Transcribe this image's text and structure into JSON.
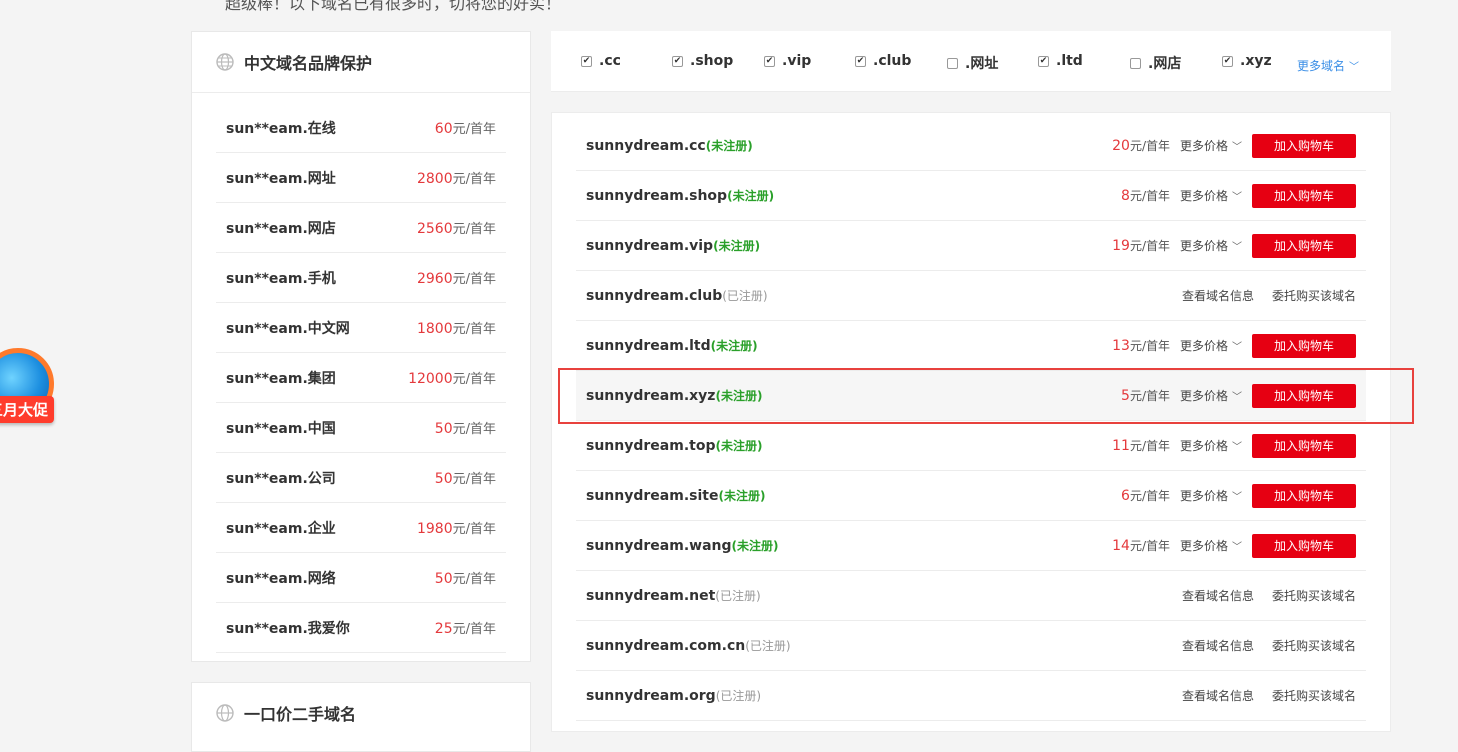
{
  "top_text": "超级棒！以下域名已有很多时，切将您的好实！",
  "left_panel": {
    "title": "中文域名品牌保护",
    "items": [
      {
        "name": "sun**eam.在线",
        "price": "60",
        "unit": "元/首年"
      },
      {
        "name": "sun**eam.网址",
        "price": "2800",
        "unit": "元/首年"
      },
      {
        "name": "sun**eam.网店",
        "price": "2560",
        "unit": "元/首年"
      },
      {
        "name": "sun**eam.手机",
        "price": "2960",
        "unit": "元/首年"
      },
      {
        "name": "sun**eam.中文网",
        "price": "1800",
        "unit": "元/首年"
      },
      {
        "name": "sun**eam.集团",
        "price": "12000",
        "unit": "元/首年"
      },
      {
        "name": "sun**eam.中国",
        "price": "50",
        "unit": "元/首年"
      },
      {
        "name": "sun**eam.公司",
        "price": "50",
        "unit": "元/首年"
      },
      {
        "name": "sun**eam.企业",
        "price": "1980",
        "unit": "元/首年"
      },
      {
        "name": "sun**eam.网络",
        "price": "50",
        "unit": "元/首年"
      },
      {
        "name": "sun**eam.我爱你",
        "price": "25",
        "unit": "元/首年"
      }
    ]
  },
  "left_panel2": {
    "title": "一口价二手域名"
  },
  "promo": {
    "label": "三月大促"
  },
  "filters": {
    "items": [
      {
        "label": ".cc",
        "checked": true
      },
      {
        "label": ".shop",
        "checked": true
      },
      {
        "label": ".vip",
        "checked": true
      },
      {
        "label": ".club",
        "checked": true
      },
      {
        "label": ".网址",
        "checked": false
      },
      {
        "label": ".ltd",
        "checked": true
      },
      {
        "label": ".网店",
        "checked": false
      },
      {
        "label": ".xyz",
        "checked": true
      }
    ],
    "more_label": "更多域名"
  },
  "results": {
    "cart_label": "加入购物车",
    "more_price_label": "更多价格",
    "whois_label": "查看域名信息",
    "broker_label": "委托购买该域名",
    "price_unit": "元/首年",
    "items": [
      {
        "domain": "sunnydream.cc",
        "status": "(未注册)",
        "available": true,
        "price": "20"
      },
      {
        "domain": "sunnydream.shop",
        "status": "(未注册)",
        "available": true,
        "price": "8"
      },
      {
        "domain": "sunnydream.vip",
        "status": "(未注册)",
        "available": true,
        "price": "19"
      },
      {
        "domain": "sunnydream.club",
        "status": "(已注册)",
        "available": false
      },
      {
        "domain": "sunnydream.ltd",
        "status": "(未注册)",
        "available": true,
        "price": "13"
      },
      {
        "domain": "sunnydream.xyz",
        "status": "(未注册)",
        "available": true,
        "price": "5",
        "highlighted": true
      },
      {
        "domain": "sunnydream.top",
        "status": "(未注册)",
        "available": true,
        "price": "11"
      },
      {
        "domain": "sunnydream.site",
        "status": "(未注册)",
        "available": true,
        "price": "6"
      },
      {
        "domain": "sunnydream.wang",
        "status": "(未注册)",
        "available": true,
        "price": "14"
      },
      {
        "domain": "sunnydream.net",
        "status": "(已注册)",
        "available": false
      },
      {
        "domain": "sunnydream.com.cn",
        "status": "(已注册)",
        "available": false
      },
      {
        "domain": "sunnydream.org",
        "status": "(已注册)",
        "available": false
      }
    ]
  },
  "colors": {
    "accent_red": "#e60012",
    "price_red": "#e4393c",
    "available_green": "#2aa02a",
    "highlight_border": "#e8413d"
  }
}
